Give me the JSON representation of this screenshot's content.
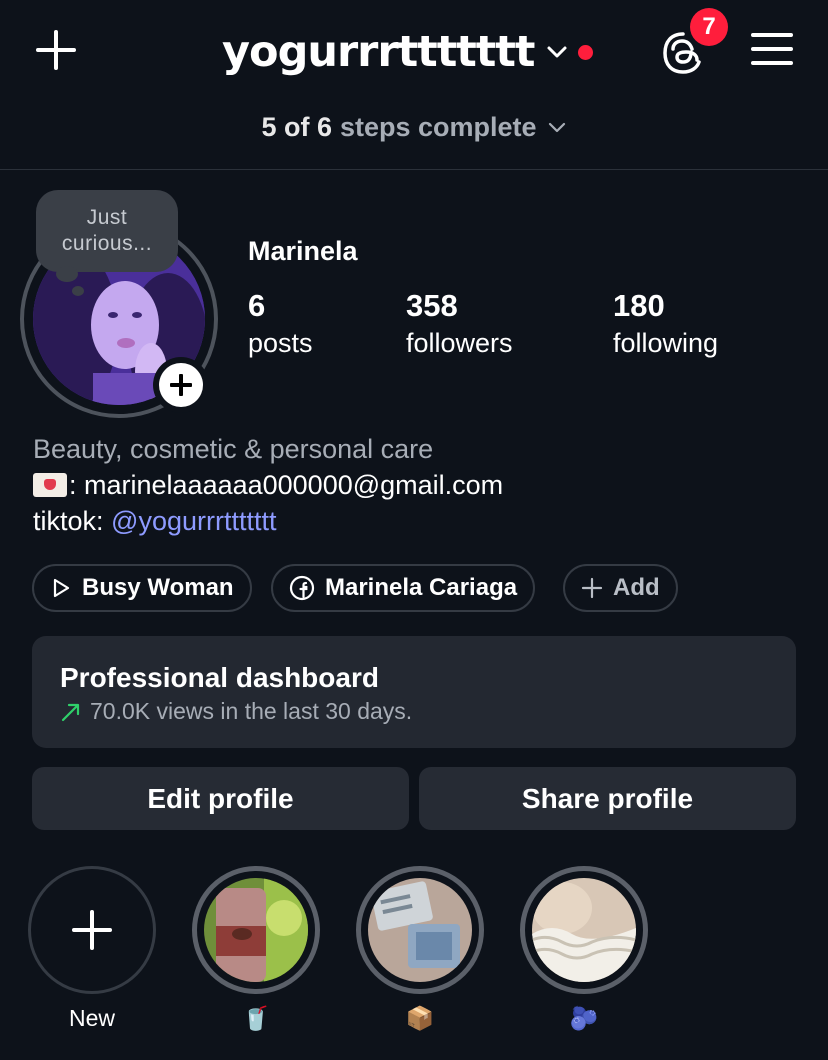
{
  "header": {
    "username": "yogurrrttttttt",
    "threads_badge": "7",
    "steps_count": "5 of 6",
    "steps_label": "steps complete"
  },
  "profile": {
    "note_line1": "Just",
    "note_line2": "curious...",
    "name": "Marinela",
    "stats": [
      {
        "value": "6",
        "label": "posts"
      },
      {
        "value": "358",
        "label": "followers"
      },
      {
        "value": "180",
        "label": "following"
      }
    ],
    "bio": {
      "category": "Beauty, cosmetic & personal care",
      "email_line": ": marinelaaaaaa000000@gmail.com",
      "tiktok_prefix": "tiktok: ",
      "tiktok_handle": "@yogurrrttttttt"
    }
  },
  "chips": [
    {
      "label": "Busy Woman",
      "icon": "play-icon"
    },
    {
      "label": "Marinela Cariaga",
      "icon": "facebook-icon"
    },
    {
      "label": "Add",
      "icon": "plus-icon"
    }
  ],
  "dashboard": {
    "title": "Professional dashboard",
    "subtitle": "70.0K views in the last 30 days."
  },
  "buttons": {
    "edit": "Edit profile",
    "share": "Share profile"
  },
  "highlights": [
    {
      "label": "New"
    },
    {
      "label": "🥤"
    },
    {
      "label": "📦"
    },
    {
      "label": "🫐"
    }
  ],
  "colors": {
    "background": "#0d121a",
    "accent_red": "#ff1e3c",
    "link_blue": "#8e9bff",
    "card": "#232831"
  }
}
